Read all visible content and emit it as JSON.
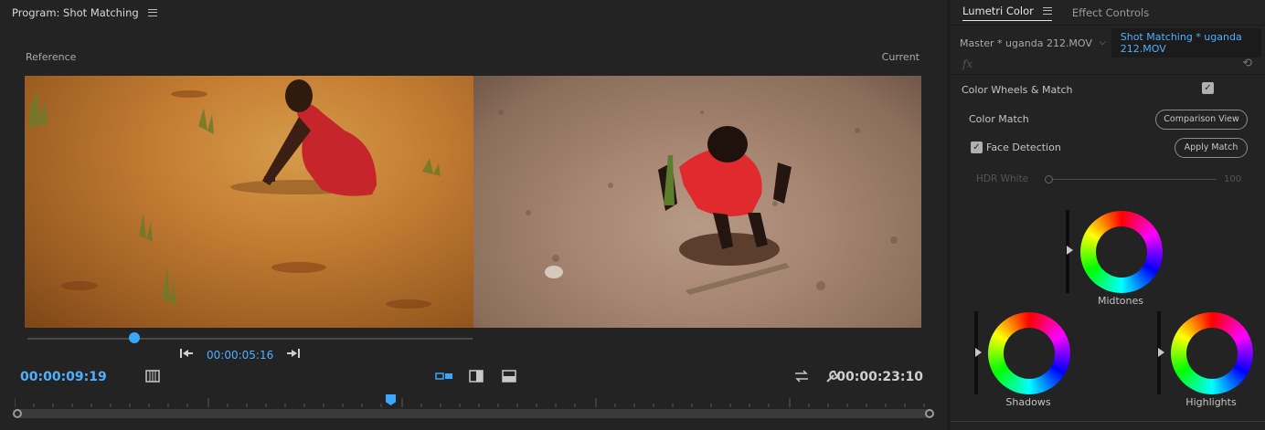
{
  "program": {
    "title": "Program: Shot Matching",
    "reference_label": "Reference",
    "current_label": "Current",
    "reference_timecode": "00:00:05:16",
    "current_timecode": "00:00:09:19",
    "duration_timecode": "00:00:23:10",
    "reference_slider_position": 0.24,
    "playhead_position": 0.41
  },
  "lumetri": {
    "tabs": [
      {
        "label": "Lumetri Color",
        "active": true
      },
      {
        "label": "Effect Controls",
        "active": false
      }
    ],
    "master_clip": "Master * uganda 212.MOV",
    "active_clip": "Shot Matching * uganda 212.MOV",
    "section_title": "Color Wheels & Match",
    "section_enabled": true,
    "color_match_label": "Color Match",
    "comparison_view_button": "Comparison View",
    "face_detection_label": "Face Detection",
    "face_detection_checked": true,
    "apply_match_button": "Apply Match",
    "hdr_white_label": "HDR White",
    "hdr_white_value": "100",
    "wheels": {
      "midtones": "Midtones",
      "shadows": "Shadows",
      "highlights": "Highlights"
    }
  },
  "colors": {
    "accent": "#3aa6ff",
    "panel_bg": "#232323"
  },
  "icons": [
    "hamburger-icon",
    "go-to-in-icon",
    "go-to-out-icon",
    "markers-icon",
    "comparison-split-icon",
    "side-by-side-icon",
    "vertical-split-icon",
    "swap-icon",
    "wrench-icon",
    "fx-icon",
    "reset-icon",
    "check-icon"
  ]
}
